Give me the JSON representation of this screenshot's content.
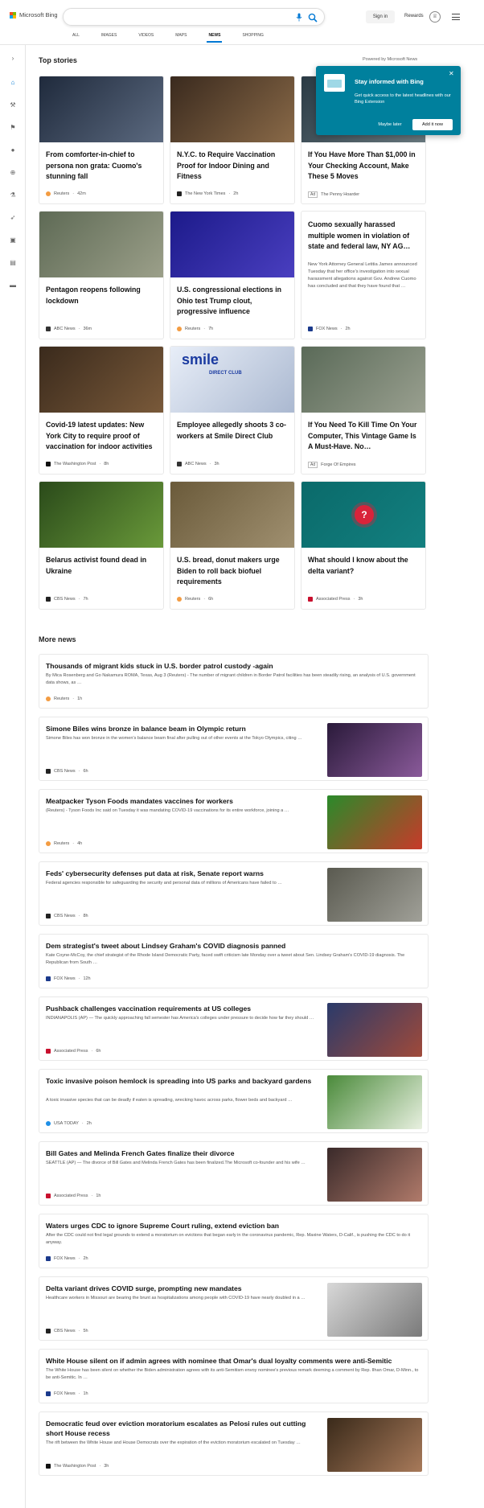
{
  "header": {
    "logo_text": "Microsoft Bing",
    "search_value": "",
    "signin_label": "Sign in",
    "rewards_label": "Rewards",
    "tabs": [
      {
        "label": "ALL",
        "active": false
      },
      {
        "label": "IMAGES",
        "active": false
      },
      {
        "label": "VIDEOS",
        "active": false
      },
      {
        "label": "MAPS",
        "active": false
      },
      {
        "label": "NEWS",
        "active": true
      },
      {
        "label": "SHOPPING",
        "active": false
      }
    ]
  },
  "rail": {
    "icons": [
      "chevron-right-icon",
      "home-icon",
      "sports-icon",
      "flag-icon",
      "location-icon",
      "globe-icon",
      "science-icon",
      "rocket-icon",
      "entertainment-icon",
      "business-icon",
      "car-icon"
    ]
  },
  "top_stories": {
    "title": "Top stories",
    "powered_by": "Powered by Microsoft News",
    "cards": [
      {
        "title": "From comforter-in-chief to persona non grata: Cuomo's stunning fall",
        "source": "Reuters",
        "time": "42m",
        "colors": [
          "#1f2a3c",
          "#5c6a80"
        ]
      },
      {
        "title": "N.Y.C. to Require Vaccination Proof for Indoor Dining and Fitness",
        "source": "The New York Times",
        "time": "2h",
        "colors": [
          "#3a2a1e",
          "#8a6a48"
        ]
      },
      {
        "title": "If You Have More Than $1,000 in Your Checking Account, Make These 5 Moves",
        "source": "The Penny Hoarder",
        "ad": "Ad",
        "colors": [
          "#2a3a44",
          "#6a7a80"
        ]
      },
      {
        "title": "Pentagon reopens following lockdown",
        "source": "ABC News",
        "time": "36m",
        "colors": [
          "#5e6a55",
          "#9ca08a"
        ]
      },
      {
        "title": "U.S. congressional elections in Ohio test Trump clout, progressive influence",
        "source": "Reuters",
        "time": "7h",
        "colors": [
          "#1c1a8a",
          "#4a3fc0"
        ]
      },
      {
        "title": "Cuomo sexually harassed multiple women in violation of state and federal law, NY AG…",
        "desc": "New York Attorney General Letitia James announced Tuesday that her office's investigation into sexual harassment allegations against Gov. Andrew Cuomo has concluded and that they have found that …",
        "source": "FOX News",
        "time": "2h"
      },
      {
        "title": "Covid-19 latest updates: New York City to require proof of vaccination for indoor activities",
        "source": "The Washington Post",
        "time": "8h",
        "colors": [
          "#3a2a1c",
          "#7a5a3a"
        ]
      },
      {
        "title": "Employee allegedly shoots 3 co-workers at Smile Direct Club",
        "source": "ABC News",
        "time": "3h",
        "colors": [
          "#e8eef8",
          "#aab8d0"
        ]
      },
      {
        "title": "If You Need To Kill Time On Your Computer, This Vintage Game Is A Must-Have. No…",
        "source": "Forge Of Empires",
        "ad": "Ad",
        "colors": [
          "#5a6a58",
          "#9aa090"
        ]
      },
      {
        "title": "Belarus activist found dead in Ukraine",
        "source": "CBS News",
        "time": "7h",
        "colors": [
          "#2a4a1a",
          "#6a9a3a"
        ]
      },
      {
        "title": "U.S. bread, donut makers urge Biden to roll back biofuel requirements",
        "source": "Reuters",
        "time": "6h",
        "colors": [
          "#6a5a3a",
          "#a09070"
        ]
      },
      {
        "title": "What should I know about the delta variant?",
        "source": "Associated Press",
        "time": "3h",
        "colors": [
          "#0a6a6a",
          "#138080"
        ]
      }
    ],
    "smile_sign": "smile",
    "smile_sub": "DIRECT CLUB"
  },
  "popup": {
    "heading": "Stay informed with Bing",
    "desc": "Get quick access to the latest headlines with our Bing Extension",
    "later_label": "Maybe later",
    "add_label": "Add it now"
  },
  "more_news": {
    "title": "More news",
    "items": [
      {
        "title": "Thousands of migrant kids stuck in U.S. border patrol custody -again",
        "desc": "By Mica Rosenberg and Go Nakamura ROMA, Texas, Aug 3 (Reuters) - The number of migrant children in Border Patrol facilities has been steadily rising, an analysis of U.S. government data shows, as …",
        "source": "Reuters",
        "time": "1h",
        "has_image": false
      },
      {
        "title": "Simone Biles wins bronze in balance beam in Olympic return",
        "desc": "Simone Biles has won bronze in the women's balance beam final after pulling out of other events at the Tokyo Olympics, citing …",
        "source": "CBS News",
        "time": "6h",
        "has_image": true
      },
      {
        "title": "Meatpacker Tyson Foods mandates vaccines for workers",
        "desc": "(Reuters) - Tyson Foods Inc said on Tuesday it was mandating COVID-19 vaccinations for its entire workforce, joining a …",
        "source": "Reuters",
        "time": "4h",
        "has_image": true
      },
      {
        "title": "Feds' cybersecurity defenses put data at risk, Senate report warns",
        "desc": "Federal agencies responsible for safeguarding the security and personal data of millions of Americans have failed to …",
        "source": "CBS News",
        "time": "8h",
        "has_image": true
      },
      {
        "title": "Dem strategist's tweet about Lindsey Graham's COVID diagnosis panned",
        "desc": "Kate Coyne-McCoy, the chief strategist of the Rhode Island Democratic Party, faced swift criticism late Monday over a tweet about Sen. Lindsey Graham's COVID-19 diagnosis. The Republican from South …",
        "source": "FOX News",
        "time": "12h",
        "has_image": false
      },
      {
        "title": "Pushback challenges vaccination requirements at US colleges",
        "desc": "INDIANAPOLIS (AP) — The quickly approaching fall semester has America's colleges under pressure to decide how far they should …",
        "source": "Associated Press",
        "time": "6h",
        "has_image": true
      },
      {
        "title": "Toxic invasive poison hemlock is spreading into US parks and backyard gardens",
        "desc": "A toxic invasive species that can be deadly if eaten is spreading, wrecking havoc across parks, flower beds and backyard …",
        "source": "USA TODAY",
        "time": "2h",
        "has_image": true
      },
      {
        "title": "Bill Gates and Melinda French Gates finalize their divorce",
        "desc": "SEATTLE (AP) — The divorce of Bill Gates and Melinda French Gates has been finalized.The Microsoft co-founder and his wife …",
        "source": "Associated Press",
        "time": "1h",
        "has_image": true
      },
      {
        "title": "Waters urges CDC to ignore Supreme Court ruling, extend eviction ban",
        "desc": "After the CDC could not find legal grounds to extend a moratorium on evictions that began early in the coronavirus pandemic, Rep. Maxine Waters, D-Calif., is pushing the CDC to do it anyway.",
        "source": "FOX News",
        "time": "2h",
        "has_image": false
      },
      {
        "title": "Delta variant drives COVID surge, prompting new mandates",
        "desc": "Healthcare workers in Missouri are bearing the brunt as hospitalizations among people with COVID-19 have nearly doubled in a …",
        "source": "CBS News",
        "time": "5h",
        "has_image": true
      },
      {
        "title": "White House silent on if admin agrees with nominee that Omar's dual loyalty comments were anti-Semitic",
        "desc": "The White House has been silent on whether the Biden administration agrees with its anti-Semitism envoy nominee's previous remark deeming a comment by Rep. Ilhan Omar, D-Minn., to be anti-Semitic. In …",
        "source": "FOX News",
        "time": "1h",
        "has_image": false
      },
      {
        "title": "Democratic feud over eviction moratorium escalates as Pelosi rules out cutting short House recess",
        "desc": "The rift between the White House and House Democrats over the expiration of the eviction moratorium escalated on Tuesday …",
        "source": "The Washington Post",
        "time": "3h",
        "has_image": true
      }
    ]
  },
  "source_colors": {
    "Reuters": "#f39c42",
    "The New York Times": "#222222",
    "ABC News": "#333333",
    "FOX News": "#1b3a8c",
    "The Washington Post": "#111111",
    "CBS News": "#222222",
    "Associated Press": "#c8102e",
    "USA TODAY": "#1f8fe6",
    "The Penny Hoarder": "#888888",
    "Forge Of Empires": "#888888"
  },
  "news_image_colors": [
    [
      "#2a1a3a",
      "#8a5a9a"
    ],
    [
      "#2a8a2a",
      "#c83a2a"
    ],
    [
      "#5a5a50",
      "#a0a098"
    ],
    [
      "#2a3a6a",
      "#a04a3a"
    ],
    [
      "#4a8a3a",
      "#e8f0e0"
    ],
    [
      "#3a2a2a",
      "#b07a6a"
    ],
    [
      "#d8d8d8",
      "#7a7a7a"
    ],
    [
      "#3a2a1a",
      "#a87a5a"
    ]
  ]
}
